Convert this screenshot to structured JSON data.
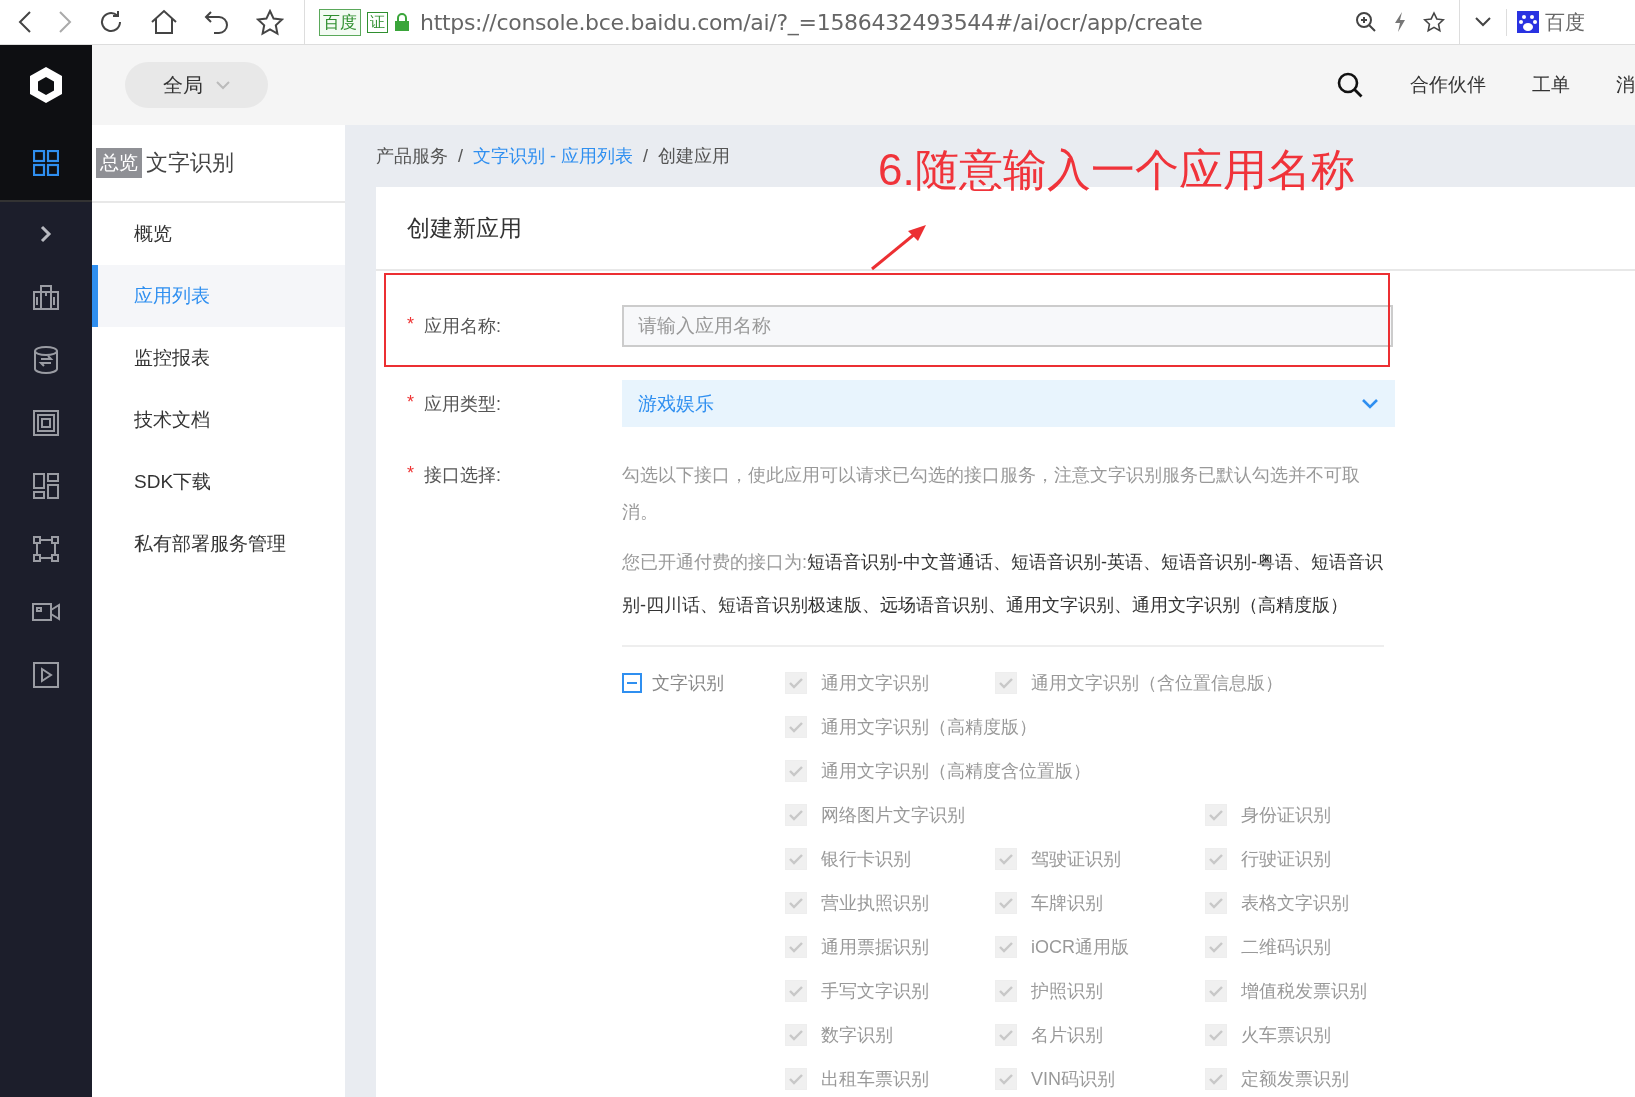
{
  "browser": {
    "site_badge": "百度",
    "cert_badge": "证",
    "url": "https://console.bce.baidu.com/ai/?_=1586432493544#/ai/ocr/app/create",
    "profile_label": "百度"
  },
  "header": {
    "region": "全局",
    "links": [
      "合作伙伴",
      "工单",
      "消"
    ]
  },
  "nav_icons": [
    {
      "kind": "grid",
      "selected": true
    },
    {
      "kind": "chevron",
      "selected": false
    },
    {
      "kind": "building",
      "selected": false
    },
    {
      "kind": "database",
      "selected": false
    },
    {
      "kind": "frame",
      "selected": false
    },
    {
      "kind": "dashboard",
      "selected": false
    },
    {
      "kind": "command",
      "selected": false
    },
    {
      "kind": "camera",
      "selected": false
    },
    {
      "kind": "play",
      "selected": false
    }
  ],
  "tooltip": "总览",
  "sidebar": {
    "title": "文字识别",
    "items": [
      {
        "label": "概览",
        "selected": false
      },
      {
        "label": "应用列表",
        "selected": true
      },
      {
        "label": "监控报表",
        "selected": false
      },
      {
        "label": "技术文档",
        "selected": false
      },
      {
        "label": "SDK下载",
        "selected": false
      },
      {
        "label": "私有部署服务管理",
        "selected": false
      }
    ]
  },
  "breadcrumb": {
    "separator": "/",
    "items": [
      {
        "label": "产品服务",
        "link": false
      },
      {
        "label": "文字识别 - 应用列表",
        "link": true
      },
      {
        "label": "创建应用",
        "link": false
      }
    ]
  },
  "required_mark": "*",
  "card_title": "创建新应用",
  "form": {
    "name": {
      "label": "应用名称:",
      "placeholder": "请输入应用名称"
    },
    "type": {
      "label": "应用类型:",
      "value": "游戏娱乐"
    },
    "apis": {
      "label": "接口选择:",
      "hint": "勾选以下接口，使此应用可以请求已勾选的接口服务，注意文字识别服务已默认勾选并不可取消。",
      "paid_label": "您已开通付费的接口为:",
      "paid_list": "短语音识别-中文普通话、短语音识别-英语、短语音识别-粤语、短语音识别-四川话、短语音识别极速版、远场语音识别、通用文字识别、通用文字识别（高精度版）",
      "group": {
        "label": "文字识别",
        "indeterminate": true
      },
      "items": [
        {
          "label": "通用文字识别",
          "checked": true,
          "disabled": true,
          "wide": false
        },
        {
          "label": "通用文字识别（含位置信息版）",
          "checked": true,
          "disabled": true,
          "wide": true
        },
        {
          "label": "通用文字识别（高精度版）",
          "checked": true,
          "disabled": true,
          "wide": true
        },
        {
          "label": "通用文字识别（高精度含位置版）",
          "checked": true,
          "disabled": true,
          "wide": true
        },
        {
          "label": "网络图片文字识别",
          "checked": true,
          "disabled": true,
          "wide": true
        },
        {
          "label": "身份证识别",
          "checked": true,
          "disabled": true,
          "wide": false
        },
        {
          "label": "银行卡识别",
          "checked": true,
          "disabled": true,
          "wide": false
        },
        {
          "label": "驾驶证识别",
          "checked": true,
          "disabled": true,
          "wide": false
        },
        {
          "label": "行驶证识别",
          "checked": true,
          "disabled": true,
          "wide": false
        },
        {
          "label": "营业执照识别",
          "checked": true,
          "disabled": true,
          "wide": false
        },
        {
          "label": "车牌识别",
          "checked": true,
          "disabled": true,
          "wide": false
        },
        {
          "label": "表格文字识别",
          "checked": true,
          "disabled": true,
          "wide": false
        },
        {
          "label": "通用票据识别",
          "checked": true,
          "disabled": true,
          "wide": false
        },
        {
          "label": "iOCR通用版",
          "checked": true,
          "disabled": true,
          "wide": false
        },
        {
          "label": "二维码识别",
          "checked": true,
          "disabled": true,
          "wide": false
        },
        {
          "label": "手写文字识别",
          "checked": true,
          "disabled": true,
          "wide": false
        },
        {
          "label": "护照识别",
          "checked": true,
          "disabled": true,
          "wide": false
        },
        {
          "label": "增值税发票识别",
          "checked": true,
          "disabled": true,
          "wide": false
        },
        {
          "label": "数字识别",
          "checked": true,
          "disabled": true,
          "wide": false
        },
        {
          "label": "名片识别",
          "checked": true,
          "disabled": true,
          "wide": false
        },
        {
          "label": "火车票识别",
          "checked": true,
          "disabled": true,
          "wide": false
        },
        {
          "label": "出租车票识别",
          "checked": true,
          "disabled": true,
          "wide": false
        },
        {
          "label": "VIN码识别",
          "checked": true,
          "disabled": true,
          "wide": false
        },
        {
          "label": "定额发票识别",
          "checked": true,
          "disabled": true,
          "wide": false
        }
      ]
    }
  },
  "annotation": {
    "text": "6.随意输入一个应用名称"
  }
}
